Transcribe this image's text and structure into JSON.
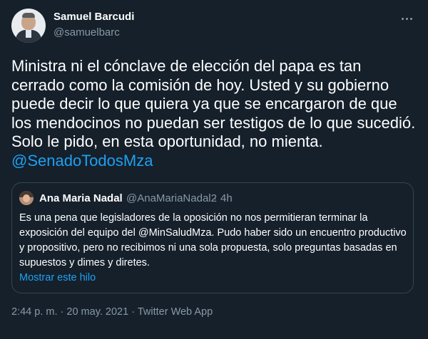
{
  "author": {
    "display_name": "Samuel Barcudi",
    "handle": "@samuelbarc"
  },
  "tweet": {
    "text": "Ministra ni el cónclave de elección del papa es tan cerrado como la comisión de hoy. Usted y su gobierno puede decir lo que quiera ya que se encargaron de que los mendocinos no puedan ser testigos de lo que sucedió. Solo le pido, en esta oportunidad, no mienta.",
    "mention": "@SenadoTodosMza"
  },
  "quoted_tweet": {
    "display_name": "Ana Maria Nadal",
    "handle": "@AnaMariaNadal2",
    "separator": "·",
    "time": "4h",
    "text": "Es una pena que legisladores de la oposición no nos permitieran terminar la exposición del equipo del @MinSaludMza. Pudo haber sido un encuentro productivo y propositivo, pero no recibimos ni una sola propuesta, solo preguntas basadas en supuestos y dimes y diretes.",
    "show_thread_label": "Mostrar este hilo"
  },
  "meta": {
    "time": "2:44 p. m.",
    "separator1": "·",
    "date": "20 may. 2021",
    "separator2": "·",
    "source": "Twitter Web App"
  },
  "icons": {
    "more": "more-horizontal-icon"
  },
  "colors": {
    "background": "#15202b",
    "text": "#ffffff",
    "secondary": "#8899a6",
    "link": "#1da1f2",
    "border": "#38444d"
  }
}
